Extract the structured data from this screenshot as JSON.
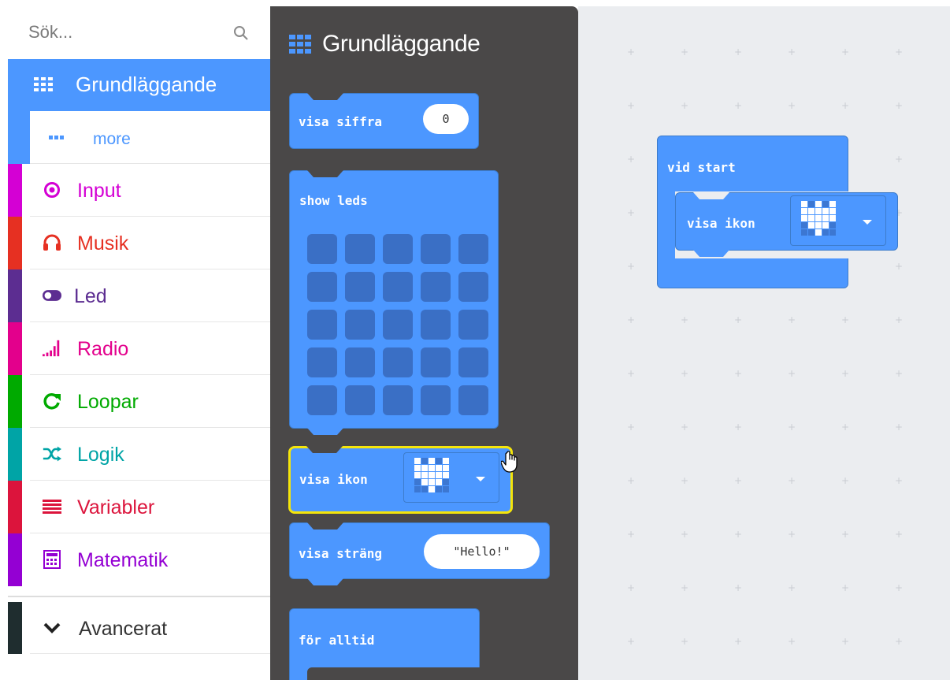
{
  "search": {
    "placeholder": "Sök..."
  },
  "toolbox": {
    "categories": [
      {
        "id": "grundlaggande",
        "label": "Grundläggande",
        "color": "#4c97ff",
        "icon": "grid-icon"
      },
      {
        "id": "more",
        "label": "more",
        "color": "#4c97ff",
        "icon": "more-dots-icon"
      },
      {
        "id": "input",
        "label": "Input",
        "color": "#d400d4",
        "icon": "radio-target-icon"
      },
      {
        "id": "musik",
        "label": "Musik",
        "color": "#e63022",
        "icon": "headphones-icon"
      },
      {
        "id": "led",
        "label": "Led",
        "color": "#5c2d91",
        "icon": "toggle-icon"
      },
      {
        "id": "radio",
        "label": "Radio",
        "color": "#e3008c",
        "icon": "signal-bars-icon"
      },
      {
        "id": "loopar",
        "label": "Loopar",
        "color": "#00aa00",
        "icon": "refresh-icon"
      },
      {
        "id": "logik",
        "label": "Logik",
        "color": "#00a4a6",
        "icon": "shuffle-icon"
      },
      {
        "id": "variabler",
        "label": "Variabler",
        "color": "#dc143c",
        "icon": "list-lines-icon"
      },
      {
        "id": "matematik",
        "label": "Matematik",
        "color": "#9400d3",
        "icon": "calculator-icon"
      }
    ],
    "advanced": {
      "label": "Avancerat",
      "color": "#1f2d2f",
      "icon": "chevron-down-icon"
    }
  },
  "flyout": {
    "title": "Grundläggande",
    "blocks": {
      "show_number": {
        "label": "visa siffra",
        "value": "0"
      },
      "show_leds": {
        "label": "show leds"
      },
      "show_icon": {
        "label": "visa ikon"
      },
      "show_string": {
        "label": "visa sträng",
        "value": "\"Hello!\""
      },
      "forever": {
        "label": "för alltid"
      }
    }
  },
  "workspace": {
    "on_start": {
      "label": "vid start"
    },
    "show_icon": {
      "label": "visa ikon"
    }
  },
  "colors": {
    "block": "#4c97ff",
    "flyout_bg": "#4a4848",
    "workspace_bg": "#ebedf0",
    "highlight": "#f5e50a"
  }
}
